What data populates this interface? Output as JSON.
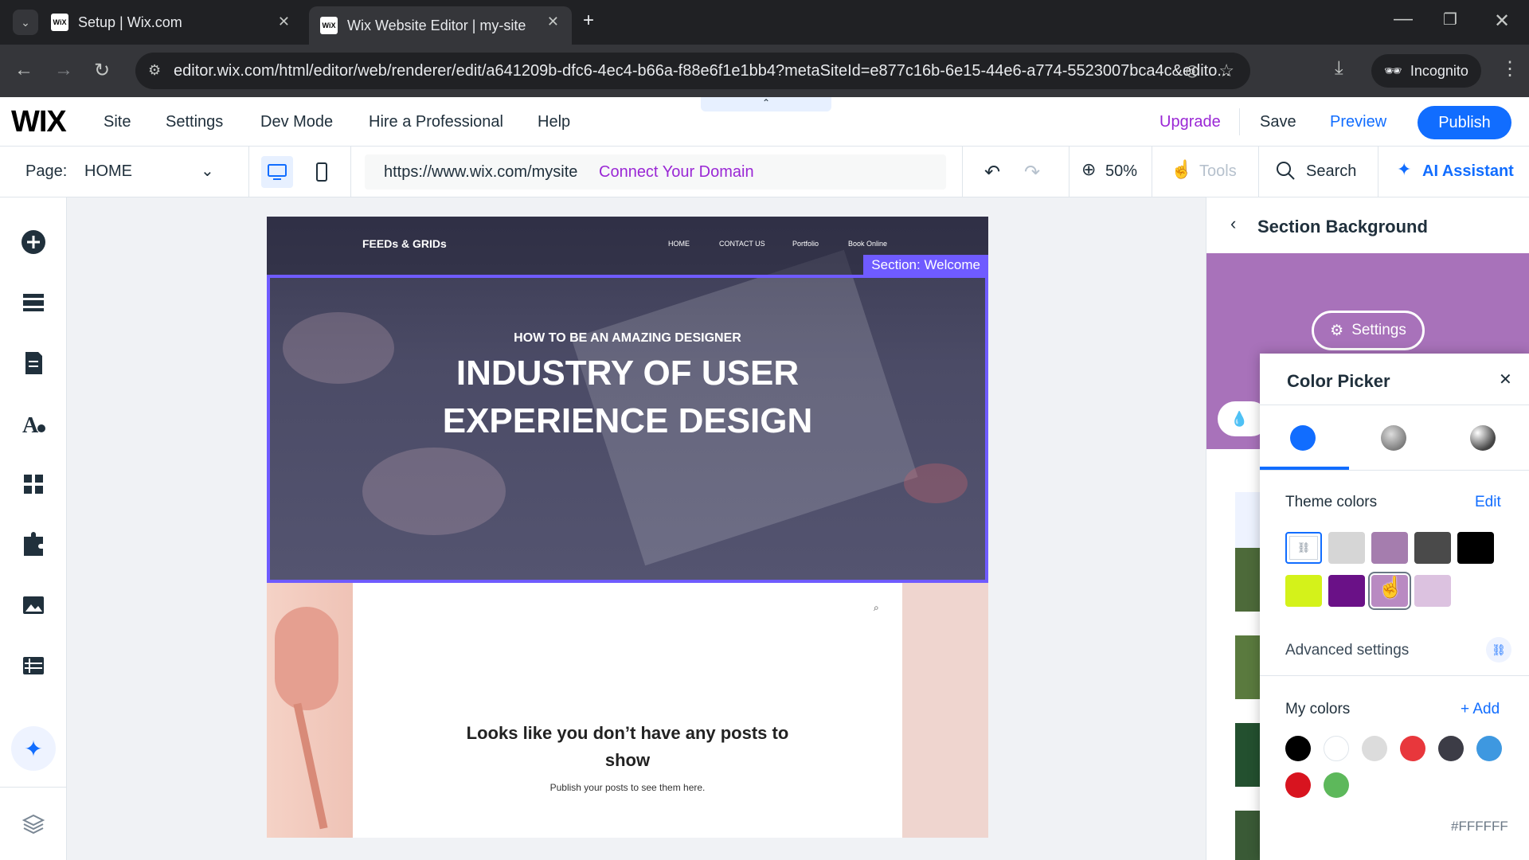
{
  "browser": {
    "tabs": [
      {
        "title": "Setup | Wix.com"
      },
      {
        "title": "Wix Website Editor | my-site"
      }
    ],
    "url": "editor.wix.com/html/editor/web/renderer/edit/a641209b-dfc6-4ec4-b66a-f88e6f1e1bb4?metaSiteId=e877c16b-6e15-44e6-a774-5523007bca4c&edito...",
    "incognito_label": "Incognito"
  },
  "topbar": {
    "logo": "WIX",
    "menu": [
      "Site",
      "Settings",
      "Dev Mode",
      "Hire a Professional",
      "Help"
    ],
    "upgrade": "Upgrade",
    "save": "Save",
    "preview": "Preview",
    "publish": "Publish"
  },
  "pagebar": {
    "page_label": "Page:",
    "page_name": "HOME",
    "site_url": "https://www.wix.com/mysite",
    "connect_domain": "Connect Your Domain",
    "zoom": "50%",
    "tools": "Tools",
    "search": "Search",
    "ai_assistant": "AI Assistant"
  },
  "site": {
    "brand": "FEEDs & GRIDs",
    "nav": [
      "HOME",
      "CONTACT US",
      "Portfolio",
      "Book Online"
    ],
    "section_tag": "Section: Welcome",
    "hero_kicker": "HOW TO BE AN AMAZING DESIGNER",
    "hero_title_1": "INDUSTRY OF USER",
    "hero_title_2": "EXPERIENCE DESIGN",
    "empty_title": "Looks like you don’t have any posts to show",
    "empty_sub": "Publish your posts to see them here."
  },
  "panel": {
    "title": "Section Background",
    "settings": "Settings"
  },
  "color_picker": {
    "title": "Color Picker",
    "theme_label": "Theme colors",
    "edit": "Edit",
    "theme_colors": [
      "#ffffff",
      "#d6d6d6",
      "#a57dae",
      "#4a4a4a",
      "#000000",
      "#d4f21a",
      "#6a1187",
      "#b98ac2",
      "#dcc2e0"
    ],
    "advanced": "Advanced settings",
    "my_colors_label": "My colors",
    "add": "+ Add",
    "my_colors": [
      "#000000",
      "#ffffff",
      "#dcdcdc",
      "#e8373c",
      "#3c3c46",
      "#3e98e0",
      "#d8141f",
      "#5db85b"
    ],
    "hex": "#FFFFFF"
  },
  "colors": {
    "accent": "#116dff",
    "upgrade": "#9a27d5",
    "selection": "#6f5bff"
  }
}
